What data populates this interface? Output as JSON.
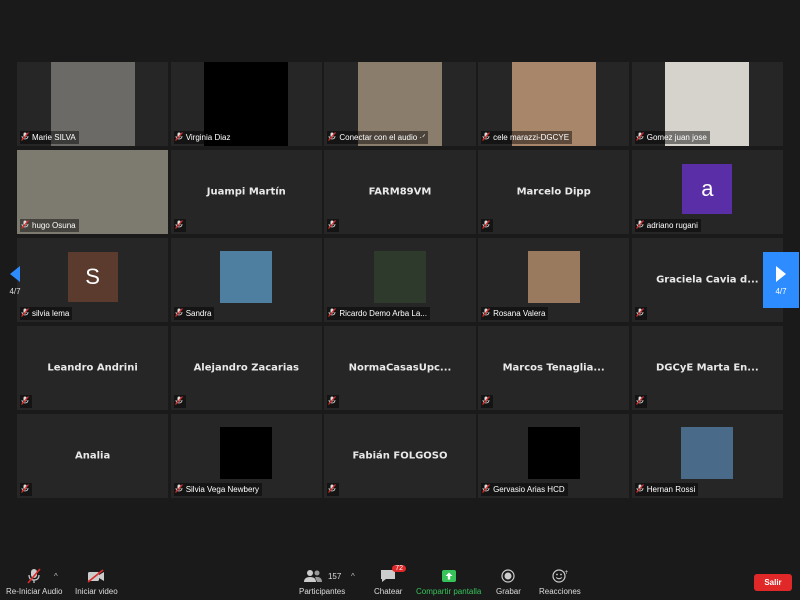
{
  "pager": {
    "left_label": "4/7",
    "right_label": "4/7"
  },
  "tiles": [
    {
      "name": "Marie SILVA",
      "kind": "video",
      "bg": "#6b6a66"
    },
    {
      "name": "Virginia Diaz",
      "kind": "video",
      "bg": "#000000"
    },
    {
      "name": "Conectar con el audio ·ᐟ",
      "kind": "video",
      "bg": "#8a7d6c"
    },
    {
      "name": "cele marazzi-DGCYE",
      "kind": "video",
      "bg": "#a8866a"
    },
    {
      "name": "Gomez juan jose",
      "kind": "video",
      "bg": "#d6d2cc"
    },
    {
      "name": "hugo Osuna",
      "kind": "video",
      "bg": "#7d7a70"
    },
    {
      "name": "Juampi Martín",
      "kind": "name"
    },
    {
      "name": "FARM89VM",
      "kind": "name"
    },
    {
      "name": "Marcelo Dipp",
      "kind": "name"
    },
    {
      "name": "adriano rugani",
      "kind": "avatar",
      "letter": "a",
      "color": "#5a2ea6"
    },
    {
      "name": "silvia lema",
      "kind": "avatar",
      "letter": "S",
      "color": "#5a3b2e"
    },
    {
      "name": "Sandra",
      "kind": "thumb",
      "color": "#4f7fa0"
    },
    {
      "name": "Ricardo Demo Arba La...",
      "kind": "thumb",
      "color": "#2e3a2c"
    },
    {
      "name": "Rosana Valera",
      "kind": "thumb",
      "color": "#9a7a5e"
    },
    {
      "name": "",
      "big": "Graciela Cavia d...",
      "kind": "name"
    },
    {
      "name": "",
      "big": "Leandro Andrini",
      "kind": "name"
    },
    {
      "name": "",
      "big": "Alejandro Zacarias",
      "kind": "name"
    },
    {
      "name": "",
      "big": "NormaCasasUpc...",
      "kind": "name"
    },
    {
      "name": "",
      "big": "Marcos Tenaglia...",
      "kind": "name"
    },
    {
      "name": "",
      "big": "DGCyE Marta En...",
      "kind": "name"
    },
    {
      "name": "",
      "big": "Analia",
      "kind": "name"
    },
    {
      "name": "Silvia Vega Newbery",
      "kind": "thumb",
      "color": "#000000"
    },
    {
      "name": "",
      "big": "Fabián FOLGOSO",
      "kind": "name"
    },
    {
      "name": "Gervasio Arias HCD",
      "kind": "thumb",
      "color": "#000000"
    },
    {
      "name": "Hernan Rossi",
      "kind": "thumb",
      "color": "#4a6a8a"
    }
  ],
  "toolbar": {
    "audio_label": "Re-Iniciar Audio",
    "video_label": "Iniciar video",
    "participants_label": "Participantes",
    "participants_count": "157",
    "chat_label": "Chatear",
    "chat_badge": "72",
    "share_label": "Compartir pantalla",
    "record_label": "Grabar",
    "reactions_label": "Reacciones",
    "leave_label": "Salir"
  }
}
